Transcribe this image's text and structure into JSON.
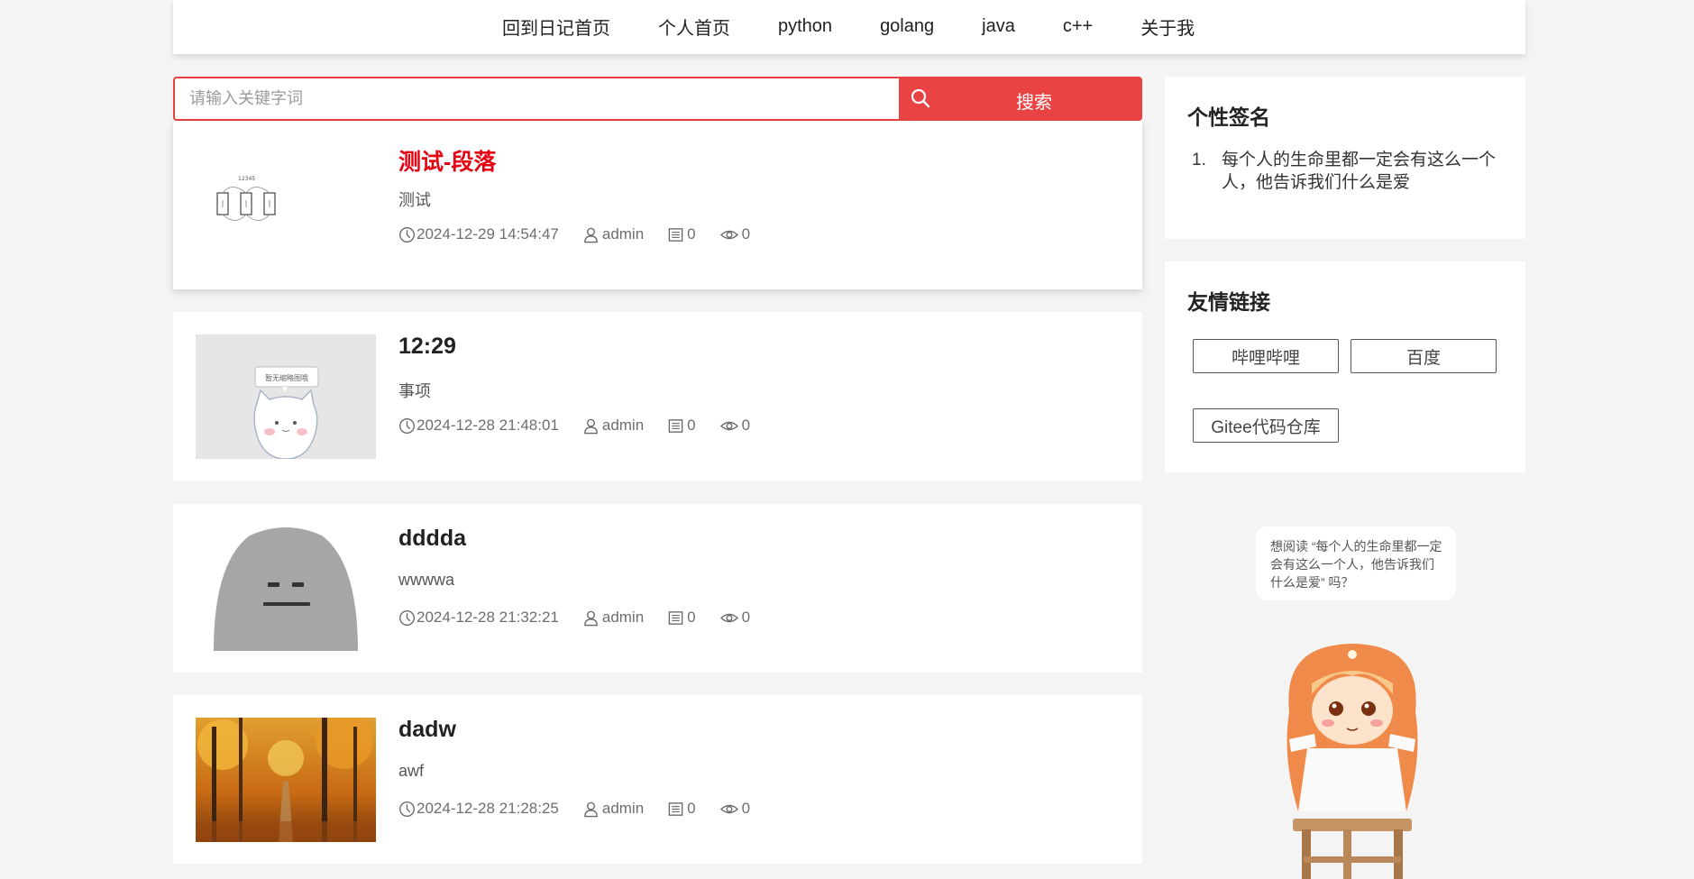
{
  "nav": {
    "items": [
      "回到日记首页",
      "个人首页",
      "python",
      "golang",
      "java",
      "c++",
      "关于我"
    ]
  },
  "search": {
    "placeholder": "请输入关键字词",
    "button_label": "搜索"
  },
  "articles": [
    {
      "title": "测试-段落",
      "summary": "测试",
      "time": "2024-12-29 14:54:47",
      "author": "admin",
      "comments": "0",
      "views": "0",
      "thumb": "diagram-sketch"
    },
    {
      "title": "12:29",
      "summary": "事项",
      "time": "2024-12-28 21:48:01",
      "author": "admin",
      "comments": "0",
      "views": "0",
      "thumb": "cat-placeholder"
    },
    {
      "title": "dddda",
      "summary": "wwwwa",
      "time": "2024-12-28 21:32:21",
      "author": "admin",
      "comments": "0",
      "views": "0",
      "thumb": "grey-blob-face"
    },
    {
      "title": "dadw",
      "summary": "awf",
      "time": "2024-12-28 21:28:25",
      "author": "admin",
      "comments": "0",
      "views": "0",
      "thumb": "autumn-forest"
    }
  ],
  "signature": {
    "title": "个性签名",
    "items": [
      {
        "num": "1.",
        "text": "每个人的生命里都一定会有这么一个人，他告诉我们什么是爱"
      }
    ]
  },
  "friend_links": {
    "title": "友情链接",
    "links": [
      "哔哩哔哩",
      "百度",
      "Gitee代码仓库"
    ]
  },
  "mascot": {
    "bubble_text": "想阅读 “每个人的生命里都一定会有这么一个人，他告诉我们什么是爱” 吗？"
  },
  "thumb_texts": {
    "diagram_numbers": "12345",
    "cat_placeholder_label": "暂无缩略图哦"
  },
  "colors": {
    "accent": "#ea4343",
    "active_title": "#e60012",
    "background": "#f4f4f4"
  }
}
